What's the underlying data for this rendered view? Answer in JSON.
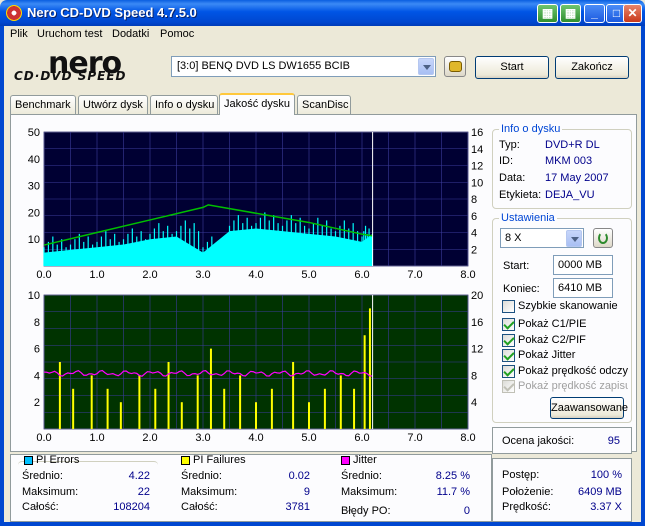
{
  "window": {
    "title": "Nero CD-DVD Speed 4.7.5.0"
  },
  "menu": [
    "Plik",
    "Uruchom test",
    "Dodatki",
    "Pomoc"
  ],
  "logo": {
    "main": "nero",
    "sub": "CD·DVD SPEED"
  },
  "drive": {
    "selected": "[3:0]   BENQ DVD LS DW1655 BCIB"
  },
  "buttons": {
    "start": "Start",
    "close": "Zakończ",
    "advanced": "Zaawansowane"
  },
  "tabs": [
    "Benchmark",
    "Utwórz dysk",
    "Info o dysku",
    "Jakość dysku",
    "ScanDisc"
  ],
  "active_tab": 3,
  "disc_info": {
    "title": "Info o dysku",
    "rows": [
      {
        "label": "Typ:",
        "value": "DVD+R DL"
      },
      {
        "label": "ID:",
        "value": "MKM 003"
      },
      {
        "label": "Data:",
        "value": "17 May 2007"
      },
      {
        "label": "Etykieta:",
        "value": "DEJA_VU"
      }
    ]
  },
  "settings": {
    "title": "Ustawienia",
    "speed": "8 X",
    "start_label": "Start:",
    "start_value": "0000 MB",
    "end_label": "Koniec:",
    "end_value": "6410 MB",
    "checkboxes": [
      {
        "label": "Szybkie skanowanie",
        "checked": false,
        "disabled": false
      },
      {
        "label": "Pokaż C1/PIE",
        "checked": true,
        "disabled": false
      },
      {
        "label": "Pokaż C2/PIF",
        "checked": true,
        "disabled": false
      },
      {
        "label": "Pokaż Jitter",
        "checked": true,
        "disabled": false
      },
      {
        "label": "Pokaż prędkość odczy",
        "checked": true,
        "disabled": false
      },
      {
        "label": "Pokaż prędkość zapisu",
        "checked": true,
        "disabled": true
      }
    ]
  },
  "quality": {
    "label": "Ocena jakości:",
    "value": "95"
  },
  "pi_errors": {
    "title": "PI Errors",
    "color": "#00c0ff",
    "rows": [
      {
        "label": "Średnio:",
        "value": "4.22"
      },
      {
        "label": "Maksimum:",
        "value": "22"
      },
      {
        "label": "Całość:",
        "value": "108204"
      }
    ]
  },
  "pi_failures": {
    "title": "PI Failures",
    "color": "#ffff00",
    "rows": [
      {
        "label": "Średnio:",
        "value": "0.02"
      },
      {
        "label": "Maksimum:",
        "value": "9"
      },
      {
        "label": "Całość:",
        "value": "3781"
      }
    ]
  },
  "jitter": {
    "title": "Jitter",
    "color": "#ff00ff",
    "rows": [
      {
        "label": "Średnio:",
        "value": "8.25 %"
      },
      {
        "label": "Maksimum:",
        "value": "11.7 %"
      }
    ],
    "po_label": "Błędy PO:",
    "po_value": "0"
  },
  "progress": {
    "rows": [
      {
        "label": "Postęp:",
        "value": "100 %"
      },
      {
        "label": "Położenie:",
        "value": "6409 MB"
      },
      {
        "label": "Prędkość:",
        "value": "3.37 X"
      }
    ]
  },
  "chart_data": [
    {
      "type": "area",
      "x_ticks": [
        "0.0",
        "1.0",
        "2.0",
        "3.0",
        "4.0",
        "5.0",
        "6.0",
        "7.0",
        "8.0"
      ],
      "y_left_ticks": [
        "50",
        "40",
        "30",
        "20",
        "10"
      ],
      "y_right_ticks": [
        "16",
        "14",
        "12",
        "10",
        "8",
        "6",
        "4",
        "2"
      ],
      "xlim": [
        0,
        8
      ],
      "ylim_left": [
        0,
        50
      ],
      "ylim_right": [
        0,
        16
      ],
      "grid": true,
      "background": "#000033",
      "series": [
        {
          "color": "#00ffff",
          "x": [
            0,
            0.5,
            1,
            1.5,
            2,
            2.5,
            3,
            3.5,
            4,
            4.5,
            5,
            5.5,
            6,
            6.2
          ],
          "y": [
            5,
            6,
            7,
            8,
            10,
            11,
            5,
            13,
            14,
            13,
            12,
            11,
            9,
            12
          ]
        },
        {
          "color": "#00c000",
          "x": [
            0,
            1,
            2,
            3,
            3.1,
            4,
            5,
            6,
            6.2
          ],
          "y": [
            2.5,
            4,
            5.5,
            7,
            7.3,
            6.3,
            5.2,
            3.8,
            3.6
          ]
        }
      ]
    },
    {
      "type": "bar",
      "x_ticks": [
        "0.0",
        "1.0",
        "2.0",
        "3.0",
        "4.0",
        "5.0",
        "6.0",
        "7.0",
        "8.0"
      ],
      "y_left_ticks": [
        "10",
        "8",
        "6",
        "4",
        "2"
      ],
      "y_right_ticks": [
        "20",
        "16",
        "12",
        "8",
        "4"
      ],
      "xlim": [
        0,
        8
      ],
      "ylim_left": [
        0,
        10
      ],
      "ylim_right": [
        0,
        20
      ],
      "grid": true,
      "background": "#003300",
      "series": [
        {
          "color": "#ffff00",
          "x": [
            0.3,
            0.55,
            0.9,
            1.2,
            1.45,
            1.8,
            2.1,
            2.35,
            2.6,
            2.9,
            3.15,
            3.4,
            3.7,
            4.0,
            4.3,
            4.7,
            5.0,
            5.3,
            5.6,
            5.85,
            6.05,
            6.15
          ],
          "y": [
            5,
            3,
            4,
            3,
            2,
            4,
            3,
            5,
            2,
            4,
            6,
            3,
            4,
            2,
            3,
            5,
            2,
            3,
            4,
            3,
            7,
            9
          ]
        },
        {
          "color": "#ff00ff",
          "x": [
            0,
            1,
            2,
            3,
            4,
            5,
            6,
            6.2
          ],
          "y": [
            8.2,
            8.3,
            8.4,
            8.3,
            8.2,
            8.1,
            8.3,
            8.4
          ]
        }
      ]
    }
  ]
}
